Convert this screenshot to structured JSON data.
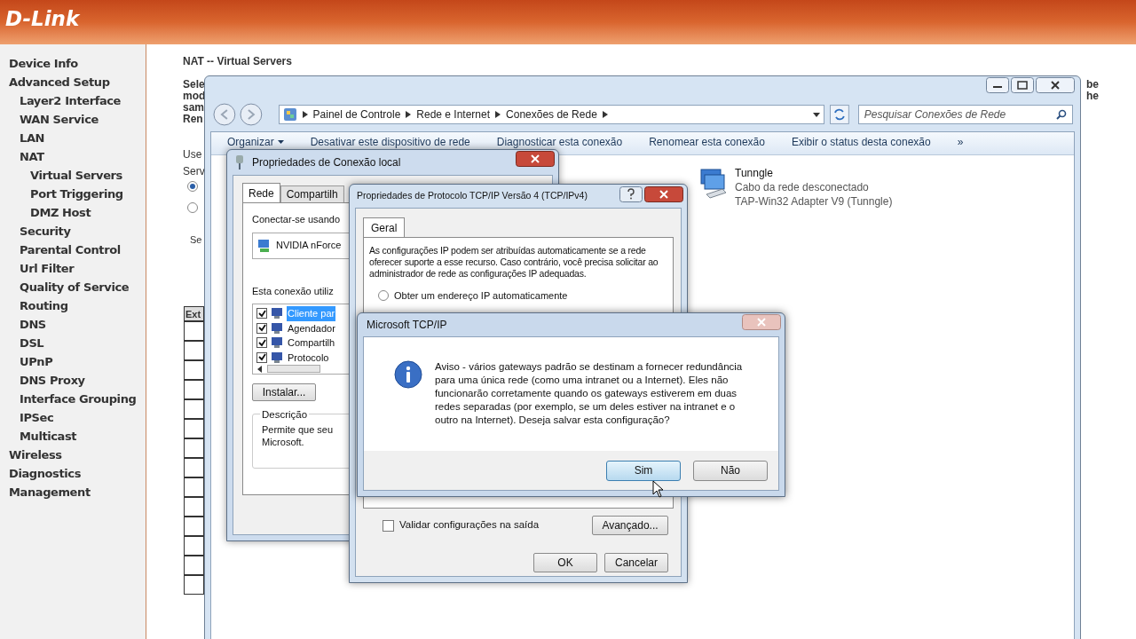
{
  "header": {
    "logo": "D-Link"
  },
  "sidebar": {
    "items": [
      {
        "label": "Device Info"
      },
      {
        "label": "Advanced Setup",
        "children": [
          {
            "label": "Layer2 Interface"
          },
          {
            "label": "WAN Service"
          },
          {
            "label": "LAN"
          },
          {
            "label": "NAT",
            "children": [
              {
                "label": "Virtual Servers"
              },
              {
                "label": "Port Triggering"
              },
              {
                "label": "DMZ Host"
              }
            ]
          },
          {
            "label": "Security"
          },
          {
            "label": "Parental Control"
          },
          {
            "label": "Url Filter"
          },
          {
            "label": "Quality of Service"
          },
          {
            "label": "Routing"
          },
          {
            "label": "DNS"
          },
          {
            "label": "DSL"
          },
          {
            "label": "UPnP"
          },
          {
            "label": "DNS Proxy"
          },
          {
            "label": "Interface Grouping"
          },
          {
            "label": "IPSec"
          },
          {
            "label": "Multicast"
          }
        ]
      },
      {
        "label": "Wireless"
      },
      {
        "label": "Diagnostics"
      },
      {
        "label": "Management"
      }
    ]
  },
  "page": {
    "title": "NAT -- Virtual Servers",
    "left_fragments": [
      "Sele",
      "mod",
      "sam",
      "Ren"
    ],
    "right_fragments": [
      "be",
      "he"
    ],
    "label_fragments": [
      "Use",
      "Serv"
    ],
    "radios": [
      {
        "selected": true
      },
      {
        "selected": false
      }
    ],
    "select_fragment": "Se",
    "table": {
      "columns": [
        "Ext"
      ]
    }
  },
  "explorer": {
    "breadcrumb": [
      "Painel de Controle",
      "Rede e Internet",
      "Conexões de Rede"
    ],
    "search": {
      "placeholder": "Pesquisar Conexões de Rede"
    },
    "toolbar": [
      {
        "label": "Organizar",
        "kind": "menu"
      },
      {
        "label": "Desativar este dispositivo de rede",
        "kind": "command"
      },
      {
        "label": "Diagnosticar esta conexão",
        "kind": "command"
      },
      {
        "label": "Renomear esta conexão",
        "kind": "command"
      },
      {
        "label": "Exibir o status desta conexão",
        "kind": "command"
      }
    ],
    "overflow": "»",
    "connections": [
      {
        "name": "Tunngle",
        "status": "Cabo da rede desconectado",
        "device": "TAP-Win32 Adapter V9 (Tunngle)"
      }
    ]
  },
  "connection_properties": {
    "title": "Propriedades de Conexão local",
    "tabs": [
      {
        "label": "Rede",
        "selected": true
      },
      {
        "label": "Compartilh",
        "selected": false
      }
    ],
    "connect_using_label": "Conectar-se usando",
    "adapter": "NVIDIA nForce",
    "items_label": "Esta conexão utiliz",
    "items": [
      {
        "label": "Cliente par",
        "checked": true,
        "selected": true
      },
      {
        "label": "Agendador",
        "checked": true,
        "selected": false
      },
      {
        "label": "Compartilh",
        "checked": true,
        "selected": false
      },
      {
        "label": "Protocolo",
        "checked": true,
        "selected": false
      }
    ],
    "install_button": "Instalar...",
    "description": {
      "title": "Descrição",
      "lines": [
        "Permite que seu",
        "Microsoft."
      ]
    }
  },
  "tcpip_properties": {
    "title": "Propriedades de Protocolo TCP/IP Versão 4 (TCP/IPv4)",
    "tabs": [
      {
        "label": "Geral",
        "selected": true
      }
    ],
    "intro": "As configurações IP podem ser atribuídas automaticamente se a rede oferecer suporte a esse recurso. Caso contrário, você precisa solicitar ao administrador de rede as configurações IP adequadas.",
    "options": [
      {
        "label": "Obter um endereço IP automaticamente",
        "selected": false
      }
    ],
    "validate": {
      "label": "Validar configurações na saída",
      "checked": false
    },
    "advanced_button": "Avançado...",
    "buttons": [
      "OK",
      "Cancelar"
    ]
  },
  "message_box": {
    "title": "Microsoft TCP/IP",
    "message": "Aviso - vários gateways padrão se destinam a fornecer redundância para uma única rede (como uma intranet ou a Internet). Eles não funcionarão corretamente quando os gateways estiverem em duas redes separadas (por exemplo, se um deles estiver na intranet e o outro na Internet). Deseja salvar esta configuração?",
    "buttons": [
      {
        "label": "Sim",
        "selected": true
      },
      {
        "label": "Não",
        "selected": false
      }
    ]
  }
}
